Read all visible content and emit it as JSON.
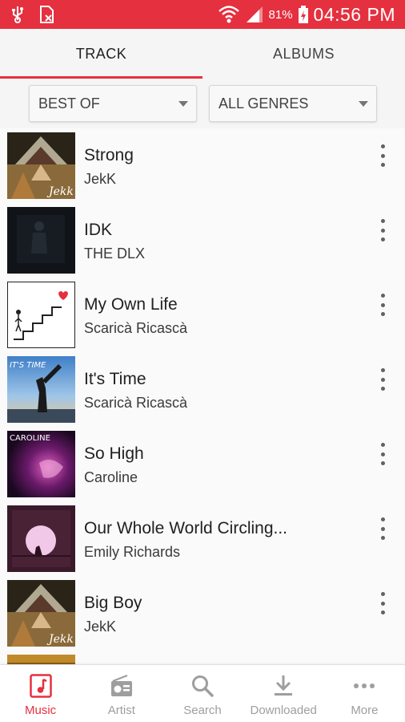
{
  "status_bar": {
    "battery_percent": "81%",
    "time": "04:56 PM",
    "background": "#e5303f"
  },
  "tabs": [
    {
      "label": "TRACK",
      "active": true
    },
    {
      "label": "ALBUMS",
      "active": false
    }
  ],
  "filters": {
    "sort": {
      "selected": "BEST OF"
    },
    "genre": {
      "selected": "ALL GENRES"
    }
  },
  "tracks": [
    {
      "title": "Strong",
      "artist": "JekK",
      "art_text": "Jekk"
    },
    {
      "title": "IDK",
      "artist": "THE DLX"
    },
    {
      "title": "My Own Life",
      "artist": "Scaricà Ricascà"
    },
    {
      "title": "It's Time",
      "artist": "Scaricà Ricascà",
      "art_text": "IT'S TIME"
    },
    {
      "title": "So High",
      "artist": "Caroline",
      "art_text": "CAROLINE"
    },
    {
      "title": "Our Whole World Circling...",
      "artist": "Emily Richards"
    },
    {
      "title": "Big Boy",
      "artist": "JekK",
      "art_text": "Jekk"
    }
  ],
  "bottom_nav": [
    {
      "label": "Music",
      "icon": "music-note-icon",
      "active": true
    },
    {
      "label": "Artist",
      "icon": "radio-icon",
      "active": false
    },
    {
      "label": "Search",
      "icon": "search-icon",
      "active": false
    },
    {
      "label": "Downloaded",
      "icon": "download-icon",
      "active": false
    },
    {
      "label": "More",
      "icon": "more-horizontal-icon",
      "active": false
    }
  ],
  "colors": {
    "accent": "#e5303f",
    "inactive_nav": "#9e9e9e"
  }
}
